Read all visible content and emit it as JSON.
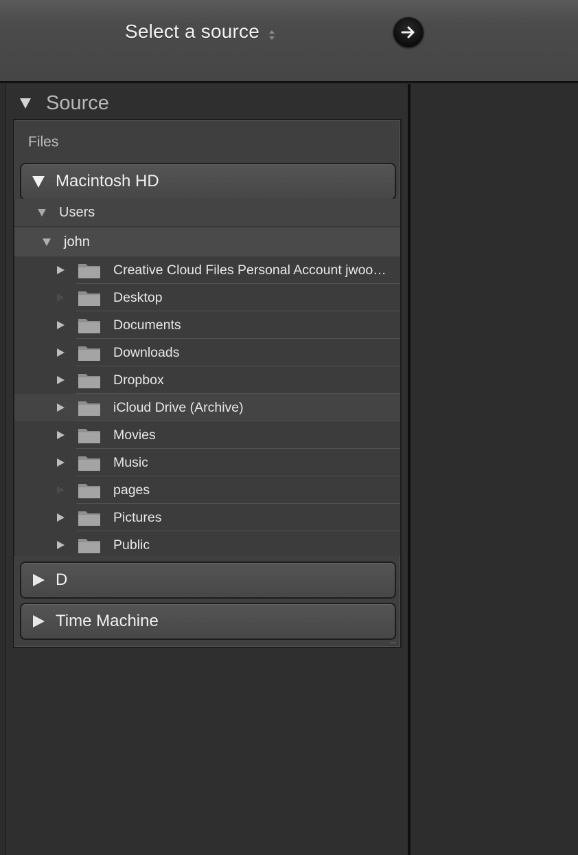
{
  "header": {
    "source_select_label": "Select a source",
    "go_icon": "arrow-right-icon"
  },
  "source_panel": {
    "title": "Source",
    "files_label": "Files",
    "volumes": [
      {
        "label": "Macintosh HD",
        "expanded": true
      },
      {
        "label": "D",
        "expanded": false
      },
      {
        "label": "Time Machine",
        "expanded": false
      }
    ],
    "tree": {
      "users_label": "Users",
      "user_label": "john",
      "folders": [
        {
          "label": "Creative Cloud Files Personal Account jwood…",
          "has_children": true
        },
        {
          "label": "Desktop",
          "has_children": false
        },
        {
          "label": "Documents",
          "has_children": true
        },
        {
          "label": "Downloads",
          "has_children": true
        },
        {
          "label": "Dropbox",
          "has_children": true
        },
        {
          "label": "iCloud Drive (Archive)",
          "has_children": true,
          "highlighted": true
        },
        {
          "label": "Movies",
          "has_children": true
        },
        {
          "label": "Music",
          "has_children": true
        },
        {
          "label": "pages",
          "has_children": false
        },
        {
          "label": "Pictures",
          "has_children": true
        },
        {
          "label": "Public",
          "has_children": true
        }
      ]
    }
  },
  "colors": {
    "topbar": "#4b4b4b",
    "panel": "#2f2f2f",
    "files_box": "#3f3f3f",
    "text": "#e8e8e8"
  }
}
